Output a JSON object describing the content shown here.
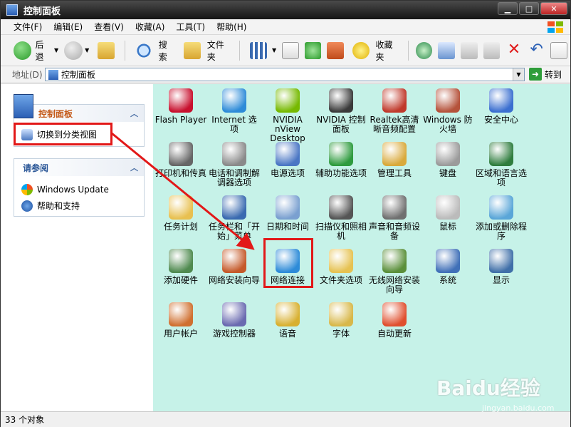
{
  "window": {
    "title": "控制面板"
  },
  "menu": [
    "文件(F)",
    "编辑(E)",
    "查看(V)",
    "收藏(A)",
    "工具(T)",
    "帮助(H)"
  ],
  "toolbar": {
    "back": "后退",
    "search": "搜索",
    "folders": "文件夹",
    "favorites": "收藏夹"
  },
  "address": {
    "label": "地址(D)",
    "value": "控制面板",
    "go": "转到"
  },
  "left": {
    "cp_title": "控制面板",
    "cp_link": "切换到分类视图",
    "see_also_title": "请参阅",
    "links": [
      "Windows Update",
      "帮助和支持"
    ]
  },
  "items": [
    {
      "name": "Flash Player",
      "color": "#c8102e"
    },
    {
      "name": "Internet 选项",
      "color": "#2d8bd8"
    },
    {
      "name": "NVIDIA nView Desktop M...",
      "color": "#76b900"
    },
    {
      "name": "NVIDIA 控制面板",
      "color": "#3a3a3a"
    },
    {
      "name": "Realtek高清晰音频配置",
      "color": "#c0392b"
    },
    {
      "name": "Windows 防火墙",
      "color": "#b5523b"
    },
    {
      "name": "安全中心",
      "color": "#3b6fd0"
    },
    {
      "name": "打印机和传真",
      "color": "#666666"
    },
    {
      "name": "电话和调制解调器选项",
      "color": "#8a8a8a"
    },
    {
      "name": "电源选项",
      "color": "#4a76c4"
    },
    {
      "name": "辅助功能选项",
      "color": "#2e9b3e"
    },
    {
      "name": "管理工具",
      "color": "#d9a93b"
    },
    {
      "name": "键盘",
      "color": "#9b9b9b"
    },
    {
      "name": "区域和语言选项",
      "color": "#2f7d3e"
    },
    {
      "name": "任务计划",
      "color": "#e8c050"
    },
    {
      "name": "任务栏和「开始」菜单",
      "color": "#3a6ab0"
    },
    {
      "name": "日期和时间",
      "color": "#7aa0d0"
    },
    {
      "name": "扫描仪和照相机",
      "color": "#555555"
    },
    {
      "name": "声音和音频设备",
      "color": "#707070"
    },
    {
      "name": "鼠标",
      "color": "#bbbbbb"
    },
    {
      "name": "添加或删除程序",
      "color": "#5aa6d8"
    },
    {
      "name": "添加硬件",
      "color": "#4f8a4f"
    },
    {
      "name": "网络安装向导",
      "color": "#c55a2a"
    },
    {
      "name": "网络连接",
      "color": "#2d8bd8"
    },
    {
      "name": "文件夹选项",
      "color": "#e6c252"
    },
    {
      "name": "无线网络安装向导",
      "color": "#5a8f3a"
    },
    {
      "name": "系统",
      "color": "#4070b8"
    },
    {
      "name": "显示",
      "color": "#3f6fa8"
    },
    {
      "name": "用户帐户",
      "color": "#d07030"
    },
    {
      "name": "游戏控制器",
      "color": "#6a6ab0"
    },
    {
      "name": "语音",
      "color": "#d8b030"
    },
    {
      "name": "字体",
      "color": "#d8b84a"
    },
    {
      "name": "自动更新",
      "color": "#e04f2e"
    }
  ],
  "status": "33 个对象",
  "watermark": "Baidu经验",
  "watermark_sub": "jingyan.baidu.com"
}
